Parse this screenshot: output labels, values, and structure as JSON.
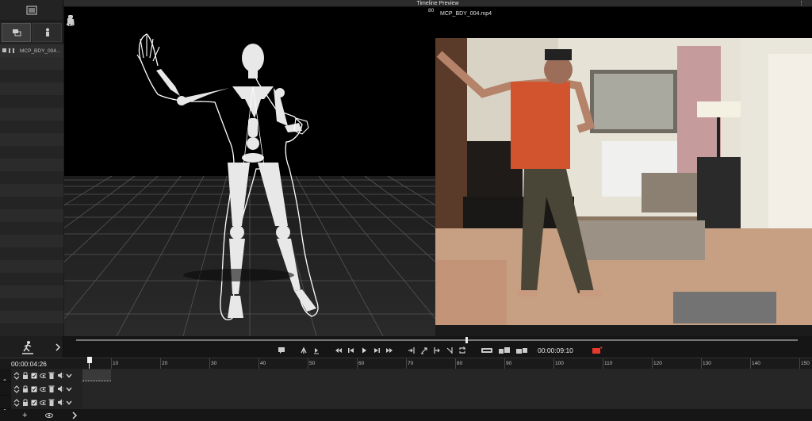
{
  "header": {
    "title": "Timeline Preview",
    "menu_glyph": "⋮"
  },
  "left_panel": {
    "assets": [
      {
        "label": "MCP_BDY_004..."
      }
    ]
  },
  "video": {
    "frame_label": "80",
    "filename": "MCP_BDY_004.mp4",
    "scrub_progress": 0.54
  },
  "transport": {
    "duration": "00:00:09:10"
  },
  "timeline": {
    "current_time": "00:00:04:26",
    "ruler_labels": [
      "10",
      "20",
      "30",
      "40",
      "50",
      "60",
      "70",
      "80",
      "90",
      "100",
      "110",
      "120",
      "130",
      "140",
      "150"
    ],
    "track_count": 3
  },
  "colors": {
    "record": "#e8372c",
    "viewport_bg": "#000000",
    "panel_bg": "#232323"
  }
}
